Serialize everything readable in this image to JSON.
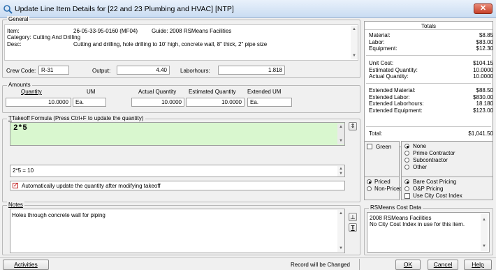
{
  "window": {
    "title": "Update Line Item Details for [22 and 23 Plumbing and HVAC] [NTP]"
  },
  "general": {
    "legend": "General",
    "item_label": "Item:",
    "item_code": "26-05-33-95-0160 (MF04)",
    "guide": "Guide: 2008 RSMeans Facilities",
    "category_label": "Category:",
    "category": "Cutting And Drilling",
    "desc_label": "Desc:",
    "desc": "Cutting and drilling, hole drilling to 10' high, concrete wall, 8\" thick, 2\" pipe size",
    "crew_label": "Crew Code:",
    "crew_value": "R-31",
    "output_label": "Output:",
    "output_value": "4.40",
    "laborhours_label": "Laborhours:",
    "laborhours_value": "1.818"
  },
  "amounts": {
    "legend": "Amounts",
    "quantity_label": "Quantity",
    "um_label": "UM",
    "actual_qty_label": "Actual Quantity",
    "est_qty_label": "Estimated Quantity",
    "ext_um_label": "Extended UM",
    "quantity_value": "10.0000",
    "um_value": "Ea.",
    "actual_qty_value": "10.0000",
    "est_qty_value": "10.0000",
    "ext_um_value": "Ea."
  },
  "takeoff": {
    "legend": "Takeoff Formula (Press Ctrl+F to update the quantity)",
    "formula": "2*5",
    "result": "2*5 = 10",
    "auto_update_label": "Automatically update the quantity after modifying takeoff",
    "auto_update_checked": true
  },
  "notes": {
    "legend": "Notes",
    "text": "Holes through concrete wall for piping"
  },
  "totals": {
    "title": "Totals",
    "group1": [
      {
        "label": "Material:",
        "value": "$8.85"
      },
      {
        "label": "Labor:",
        "value": "$83.00"
      },
      {
        "label": "Equipment:",
        "value": "$12.30"
      }
    ],
    "group2": [
      {
        "label": "Unit Cost:",
        "value": "$104.15"
      },
      {
        "label": "Estimated Quantity:",
        "value": "10.0000"
      },
      {
        "label": "Actual Quantity:",
        "value": "10.0000"
      }
    ],
    "group3": [
      {
        "label": "Extended Material:",
        "value": "$88.50"
      },
      {
        "label": "Extended Labor:",
        "value": "$830.00"
      },
      {
        "label": "Extended Laborhours:",
        "value": "18.180"
      },
      {
        "label": "Extended Equipment:",
        "value": "$123.00"
      }
    ],
    "total_label": "Total:",
    "total_value": "$1,041.50"
  },
  "options": {
    "green_label": "Green",
    "contractor": [
      "None",
      "Prime Contractor",
      "Subcontractor",
      "Other"
    ],
    "priced": [
      "Priced",
      "Non-Priced"
    ],
    "pricing": [
      "Bare Cost Pricing",
      "O&P Pricing"
    ],
    "city_index_label": "Use City Cost Index"
  },
  "rsmeans": {
    "legend": "RSMeans Cost Data",
    "line1": "2008 RSMeans Facilities",
    "line2": "No City Cost Index in use for this item."
  },
  "footer": {
    "activities": "Activities",
    "status": "Record will be Changed",
    "ok": "OK",
    "cancel": "Cancel",
    "help": "Help"
  },
  "colors": {
    "formula_bg": "#d9f7cf",
    "close_btn": "#c7412a"
  }
}
